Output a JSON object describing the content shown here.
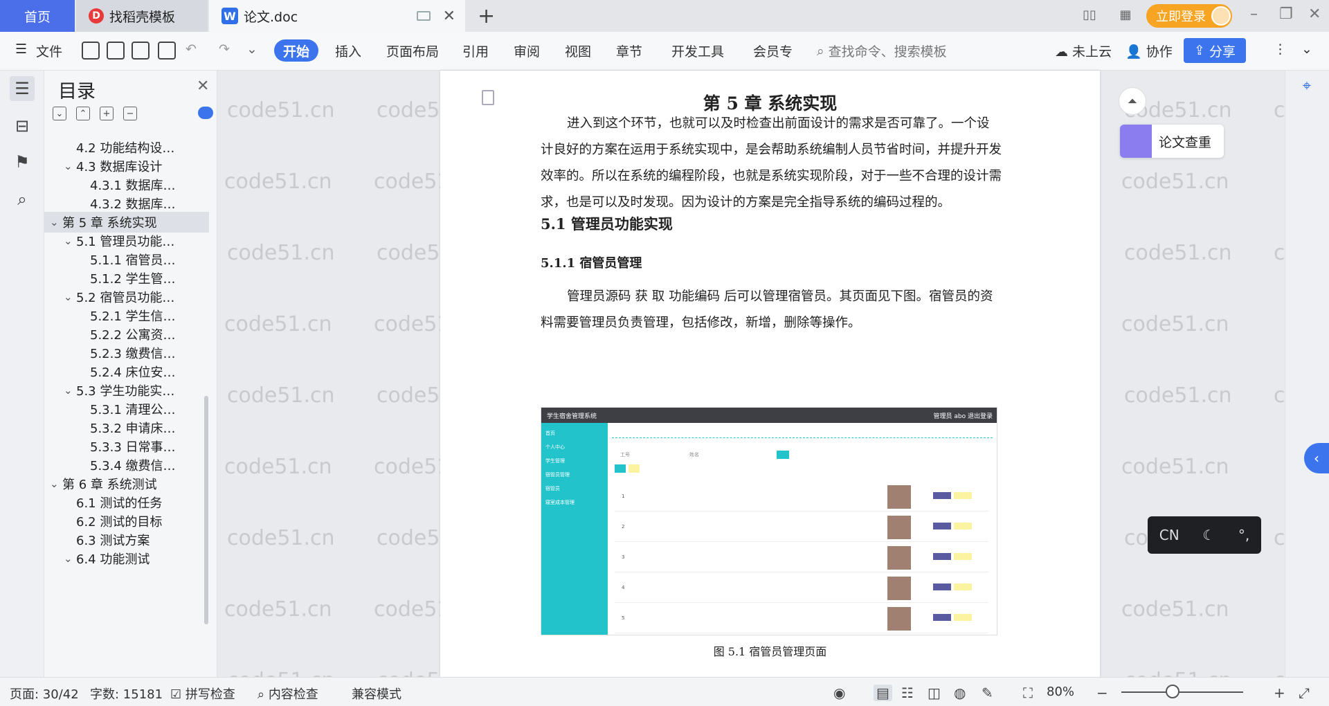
{
  "tabs": {
    "home": "首页",
    "template": "找稻壳模板",
    "doc": "论文.doc"
  },
  "titlebar": {
    "login": "立即登录"
  },
  "menu": {
    "file": "文件",
    "items": [
      "开始",
      "插入",
      "页面布局",
      "引用",
      "审阅",
      "视图",
      "章节",
      "开发工具",
      "会员专"
    ],
    "search": "查找命令、搜索模板",
    "cloud": "未上云",
    "collab": "协作",
    "share": "分享"
  },
  "toc": {
    "title": "目录",
    "items": [
      {
        "label": "4.2  功能结构设…",
        "level": 2,
        "chevron": false
      },
      {
        "label": "4.3  数据库设计",
        "level": 2,
        "chevron": true
      },
      {
        "label": "4.3.1  数据库…",
        "level": 3,
        "chevron": false
      },
      {
        "label": "4.3.2  数据库…",
        "level": 3,
        "chevron": false
      },
      {
        "label": "第 5 章  系统实现",
        "level": 1,
        "chevron": true,
        "selected": true
      },
      {
        "label": "5.1  管理员功能…",
        "level": 2,
        "chevron": true
      },
      {
        "label": "5.1.1  宿管员…",
        "level": 3,
        "chevron": false
      },
      {
        "label": "5.1.2  学生管…",
        "level": 3,
        "chevron": false
      },
      {
        "label": "5.2  宿管员功能…",
        "level": 2,
        "chevron": true
      },
      {
        "label": "5.2.1  学生信…",
        "level": 3,
        "chevron": false
      },
      {
        "label": "5.2.2  公寓资…",
        "level": 3,
        "chevron": false
      },
      {
        "label": "5.2.3  缴费信…",
        "level": 3,
        "chevron": false
      },
      {
        "label": "5.2.4  床位安…",
        "level": 3,
        "chevron": false
      },
      {
        "label": "5.3  学生功能实…",
        "level": 2,
        "chevron": true
      },
      {
        "label": "5.3.1  清理公…",
        "level": 3,
        "chevron": false
      },
      {
        "label": "5.3.2  申请床…",
        "level": 3,
        "chevron": false
      },
      {
        "label": "5.3.3  日常事…",
        "level": 3,
        "chevron": false
      },
      {
        "label": "5.3.4  缴费信…",
        "level": 3,
        "chevron": false
      },
      {
        "label": "第 6 章  系统测试",
        "level": 1,
        "chevron": true
      },
      {
        "label": "6.1  测试的任务",
        "level": 2,
        "chevron": false
      },
      {
        "label": "6.2  测试的目标",
        "level": 2,
        "chevron": false
      },
      {
        "label": "6.3  测试方案",
        "level": 2,
        "chevron": false
      },
      {
        "label": "6.4  功能测试",
        "level": 2,
        "chevron": true
      }
    ]
  },
  "doc": {
    "chapter_title": "第 5 章  系统实现",
    "para1": "进入到这个环节，也就可以及时检查出前面设计的需求是否可靠了。一个设计良好的方案在运用于系统实现中，是会帮助系统编制人员节省时间，并提升开发效率的。所以在系统的编程阶段，也就是系统实现阶段，对于一些不合理的设计需求，也是可以及时发现。因为设计的方案是完全指导系统的编码过程的。",
    "h2": "5.1  管理员功能实现",
    "h3": "5.1.1  宿管员管理",
    "para2": "管理员源码 获 取 功能编码 后可以管理宿管员。其页面见下图。宿管员的资料需要管理员负责管理，包括修改，新增，删除等操作。",
    "caption": "图 5.1  宿管员管理页面",
    "shot": {
      "title": "学生宿舍管理系统",
      "user": "管理员 abo    退出登录",
      "menu": [
        "首页",
        "个人中心",
        "学生管理",
        "宿管员管理",
        "宿管员",
        "寝室成本管理"
      ],
      "filter1": "工号",
      "filter2": "姓名",
      "rows": [
        "1",
        "2",
        "3",
        "4",
        "5"
      ]
    }
  },
  "right": {
    "check": "论文查重",
    "ime": "CN"
  },
  "watermark": "code51.cn",
  "status": {
    "page": "页面: 30/42",
    "words": "字数: 15181",
    "spell": "拼写检查",
    "content": "内容检查",
    "compat": "兼容模式",
    "zoom": "80%"
  }
}
